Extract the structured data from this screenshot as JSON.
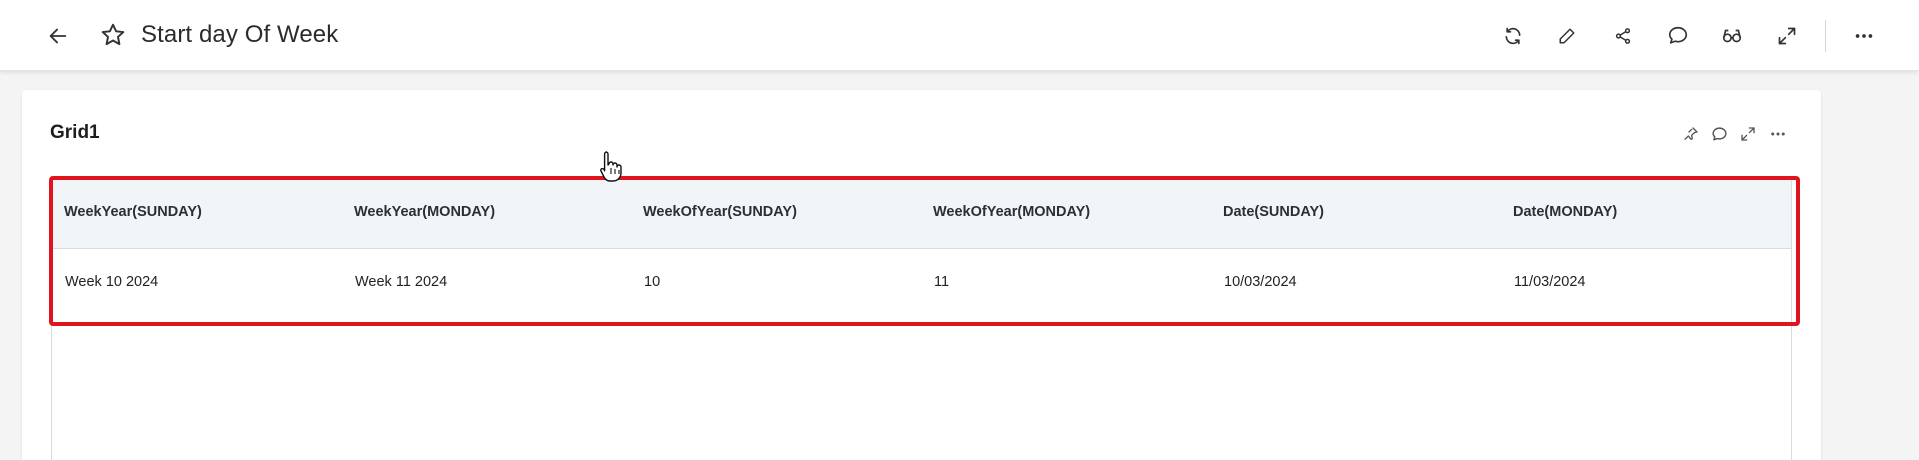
{
  "header": {
    "title": "Start day Of Week",
    "back_icon": "arrow-left-icon",
    "favorite_icon": "star-icon",
    "actions": [
      "refresh-icon",
      "edit-icon",
      "share-icon",
      "comment-icon",
      "view-icon",
      "expand-icon",
      "more-icon"
    ]
  },
  "widget": {
    "title": "Grid1",
    "actions": [
      "pin-icon",
      "comment-icon",
      "expand-icon",
      "more-icon"
    ]
  },
  "grid": {
    "columns": [
      "WeekYear(SUNDAY)",
      "WeekYear(MONDAY)",
      "WeekOfYear(SUNDAY)",
      "WeekOfYear(MONDAY)",
      "Date(SUNDAY)",
      "Date(MONDAY)"
    ],
    "rows": [
      [
        "Week 10 2024",
        "Week 11 2024",
        "10",
        "11",
        "10/03/2024",
        "11/03/2024"
      ]
    ]
  },
  "colors": {
    "highlight": "#e1131d",
    "header_bg": "#f2f5f8"
  }
}
